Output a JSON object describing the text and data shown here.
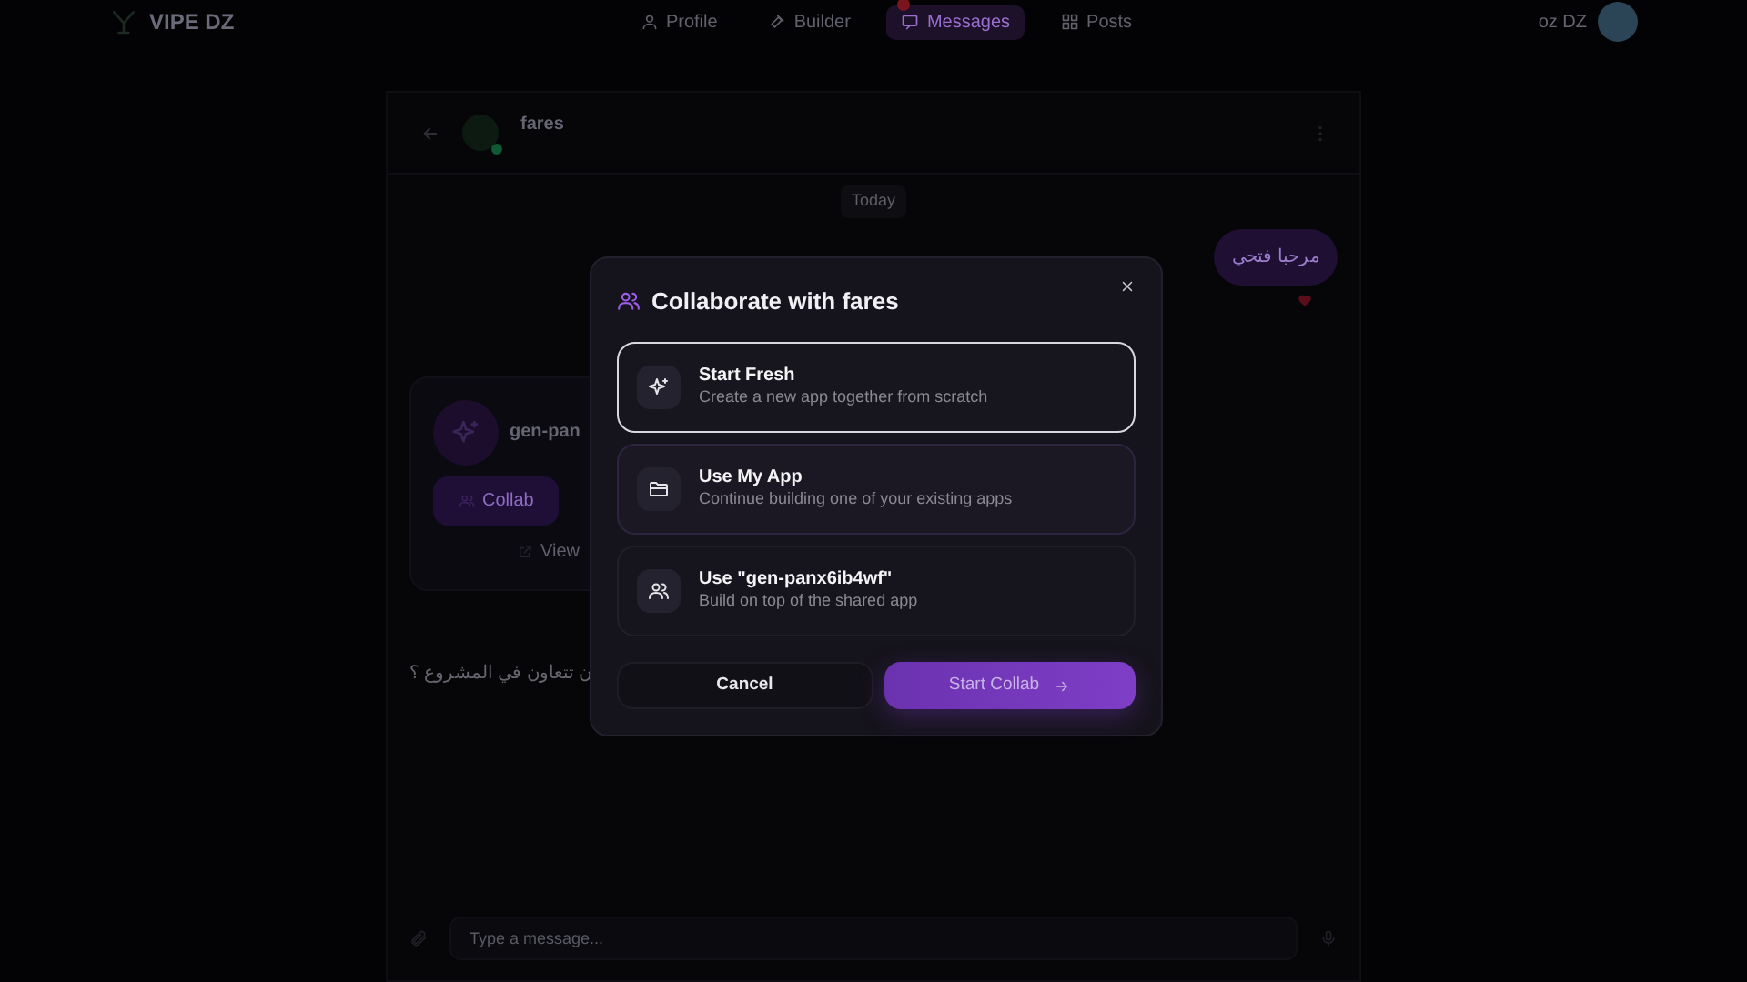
{
  "navbar": {
    "brand": "VIPE DZ",
    "links": [
      {
        "label": "Profile",
        "selected": false,
        "unread": false
      },
      {
        "label": "Builder",
        "selected": false,
        "unread": false
      },
      {
        "label": "Messages",
        "selected": true,
        "unread": true
      },
      {
        "label": "Posts",
        "selected": false,
        "unread": false
      }
    ],
    "user": "oz DZ"
  },
  "chat": {
    "contact": "fares",
    "online": true,
    "day": "Today",
    "messages": [
      {
        "kind": "text",
        "outgoing": true,
        "text": "مرحبا فتحي",
        "reacted": true
      },
      {
        "kind": "app",
        "outgoing": false,
        "title": "gen-pan",
        "collab_label": "Collab",
        "view_label": "View"
      },
      {
        "kind": "text",
        "outgoing": false,
        "text": "ن تتعاون في المشروع ؟",
        "reacted": false
      }
    ],
    "input_placeholder": "Type a message..."
  },
  "modal": {
    "title": "Collaborate with fares",
    "options": [
      {
        "title": "Start Fresh",
        "subtitle": "Create a new app together from scratch",
        "selected": true
      },
      {
        "title": "Use My App",
        "subtitle": "Continue building one of your existing apps",
        "selected": false
      },
      {
        "title": "Use \"gen-panx6ib4wf\"",
        "subtitle": "Build on top of the shared app",
        "selected": false
      }
    ],
    "cancel": "Cancel",
    "confirm": "Start Collab"
  }
}
